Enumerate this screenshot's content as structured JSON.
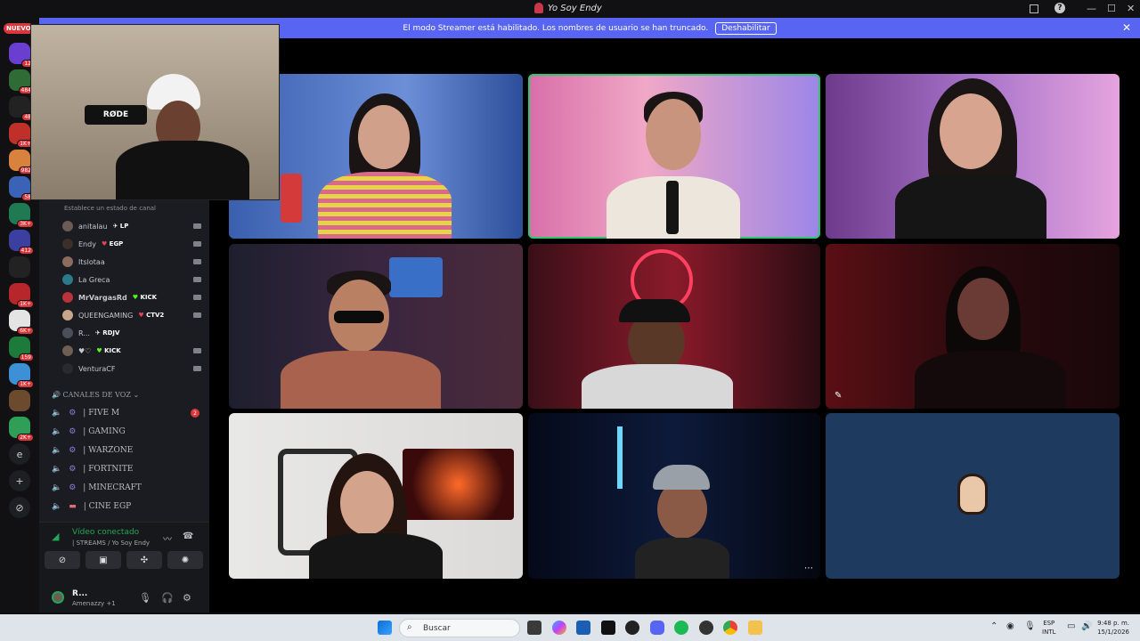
{
  "window": {
    "title": "Yo Soy Endy",
    "controls": [
      "—",
      "☐",
      "✕"
    ]
  },
  "banner": {
    "message": "El modo Streamer está habilitado. Los nombres de usuario se han truncado.",
    "button": "Deshabilitar"
  },
  "rail": {
    "new_badge": "NUEVO",
    "servers": [
      {
        "count": "12",
        "color": "#6a3fd0"
      },
      {
        "count": "484",
        "color": "#2e6b35"
      },
      {
        "count": "48",
        "color": "#222"
      },
      {
        "count": "1K+",
        "color": "#c0302b"
      },
      {
        "count": "982",
        "color": "#d9823d"
      },
      {
        "count": "58",
        "color": "#3a63b8"
      },
      {
        "count": "3K+",
        "color": "#1f7a54"
      },
      {
        "count": "412",
        "color": "#3a3fa0"
      },
      {
        "count": "",
        "color": "#222"
      },
      {
        "count": "1K+",
        "color": "#b7262a"
      },
      {
        "count": "6K+",
        "color": "#e4e4e4"
      },
      {
        "count": "159",
        "color": "#1d7a3a"
      },
      {
        "count": "1K+",
        "color": "#3d8fd6"
      },
      {
        "count": "",
        "color": "#6b4a2d"
      },
      {
        "count": "2K+",
        "color": "#2f9e57"
      }
    ],
    "letter_server": "e",
    "add_icon": "+",
    "discover_icon": "⊘"
  },
  "sidebar": {
    "channel_hint": "Establece un estado de canal",
    "voice_users": [
      {
        "name": "anitalau",
        "tag": "LP",
        "tag_icon": "✈"
      },
      {
        "name": "Endy",
        "tag": "EGP",
        "tag_icon": "♥"
      },
      {
        "name": "Itslotaa",
        "tag": "",
        "tag_icon": ""
      },
      {
        "name": "La Greca",
        "tag": "",
        "tag_icon": ""
      },
      {
        "name": "MrVargasRd",
        "tag": "KICK",
        "tag_icon": "♥"
      },
      {
        "name": "QUEENGAMING",
        "tag": "CTV2",
        "tag_icon": "♥"
      },
      {
        "name": "R...",
        "tag": "RDJV",
        "tag_icon": "✈"
      },
      {
        "name": "♥♡",
        "tag": "KICK",
        "tag_icon": "♥"
      },
      {
        "name": "VenturaCF",
        "tag": "",
        "tag_icon": ""
      }
    ],
    "voice_category": "CANALES DE VOZ",
    "voice_channels": [
      {
        "name": "| FIVE M",
        "count": "2"
      },
      {
        "name": "| GAMING",
        "count": ""
      },
      {
        "name": "| WARZONE",
        "count": ""
      },
      {
        "name": "| FORTNITE",
        "count": ""
      },
      {
        "name": "| MINECRAFT",
        "count": ""
      },
      {
        "name": "| CINE EGP",
        "count": ""
      }
    ],
    "voice_panel": {
      "status": "Vídeo conectado",
      "channel": "| STREAMS / Yo Soy Endy"
    },
    "user": {
      "name": "R...",
      "status": "Amenazzy +1"
    }
  },
  "pip": {
    "mic_brand": "RØDE"
  },
  "taskbar": {
    "search_placeholder": "Buscar",
    "lang_top": "ESP",
    "lang_bottom": "INTL",
    "time": "9:48 p. m.",
    "date": "15/1/2026"
  },
  "colors": {
    "accent": "#5865f2",
    "speaking": "#2dc770",
    "danger": "#da373c"
  }
}
